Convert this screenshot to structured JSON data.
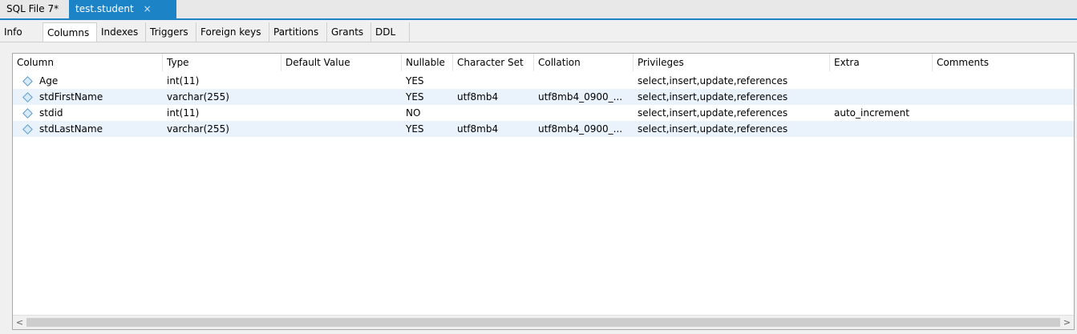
{
  "doc_tabs": [
    {
      "label": "SQL File 7*"
    },
    {
      "label": "test.student",
      "close": "×"
    }
  ],
  "sub_tabs": [
    "Info",
    "Columns",
    "Indexes",
    "Triggers",
    "Foreign keys",
    "Partitions",
    "Grants",
    "DDL"
  ],
  "active_sub_tab": "Columns",
  "table": {
    "headers": [
      "Column",
      "Type",
      "Default Value",
      "Nullable",
      "Character Set",
      "Collation",
      "Privileges",
      "Extra",
      "Comments"
    ],
    "rows": [
      [
        "Age",
        "int(11)",
        "",
        "YES",
        "",
        "",
        "select,insert,update,references",
        "",
        ""
      ],
      [
        "stdFirstName",
        "varchar(255)",
        "",
        "YES",
        "utf8mb4",
        "utf8mb4_0900_...",
        "select,insert,update,references",
        "",
        ""
      ],
      [
        "stdid",
        "int(11)",
        "",
        "NO",
        "",
        "",
        "select,insert,update,references",
        "auto_increment",
        ""
      ],
      [
        "stdLastName",
        "varchar(255)",
        "",
        "YES",
        "utf8mb4",
        "utf8mb4_0900_...",
        "select,insert,update,references",
        "",
        ""
      ]
    ]
  },
  "scroll": {
    "left": "<",
    "right": ">"
  },
  "colors": {
    "accent": "#1c84c6",
    "alt_row": "#eaf2fb"
  }
}
